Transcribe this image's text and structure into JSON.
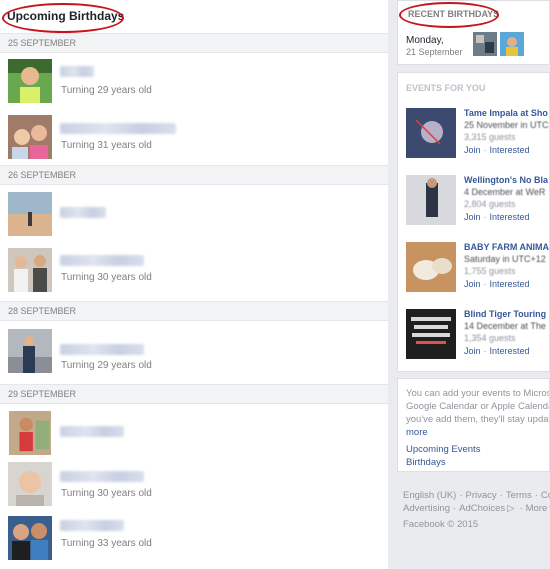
{
  "main": {
    "title": "Upcoming Birthdays",
    "groups": [
      {
        "date": "25 SEPTEMBER",
        "people": [
          {
            "age": "Turning 29 years old"
          },
          {
            "age": "Turning 31 years old"
          }
        ]
      },
      {
        "date": "26 SEPTEMBER",
        "people": [
          {
            "age": ""
          },
          {
            "age": "Turning 30 years old"
          }
        ]
      },
      {
        "date": "28 SEPTEMBER",
        "people": [
          {
            "age": "Turning 29 years old"
          }
        ]
      },
      {
        "date": "29 SEPTEMBER",
        "people": [
          {
            "age": ""
          },
          {
            "age": "Turning 30 years old"
          },
          {
            "age": "Turning 33 years old"
          }
        ]
      }
    ]
  },
  "recent": {
    "heading": "RECENT BIRTHDAYS",
    "day": "Monday,",
    "date": "21 September"
  },
  "events": {
    "heading": "EVENTS FOR YOU",
    "items": [
      {
        "title": "Tame Impala at Sho",
        "date": "25 November in UTC",
        "guests": "3,315 guests",
        "join": "Join",
        "interested": "Interested"
      },
      {
        "title": "Wellington's No Bla",
        "date": "4 December at WeR",
        "guests": "2,804 guests",
        "join": "Join",
        "interested": "Interested"
      },
      {
        "title": "BABY FARM ANIMAL",
        "date": "Saturday in UTC+12",
        "guests": "1,755 guests",
        "join": "Join",
        "interested": "Interested"
      },
      {
        "title": "Blind Tiger Touring",
        "date": "14 December at The",
        "guests": "1,354 guests",
        "join": "Join",
        "interested": "Interested"
      }
    ]
  },
  "info": {
    "line1": "You can add your events to Micros",
    "line2": "Google Calendar or Apple Calenda",
    "line3": "you've add them, they'll stay updat",
    "more": "more",
    "upcoming_events": "Upcoming Events",
    "birthdays": "Birthdays"
  },
  "footer": {
    "language": "English (UK)",
    "privacy": "Privacy",
    "terms": "Terms",
    "cookies_partial": "Co",
    "advertising": "Advertising",
    "adchoices": "AdChoices",
    "more": "More",
    "copyright": "Facebook © 2015"
  },
  "colors": {
    "accent_link": "#365899",
    "annotation_oval": "#c4151c",
    "page_bg": "#e9ebee"
  }
}
